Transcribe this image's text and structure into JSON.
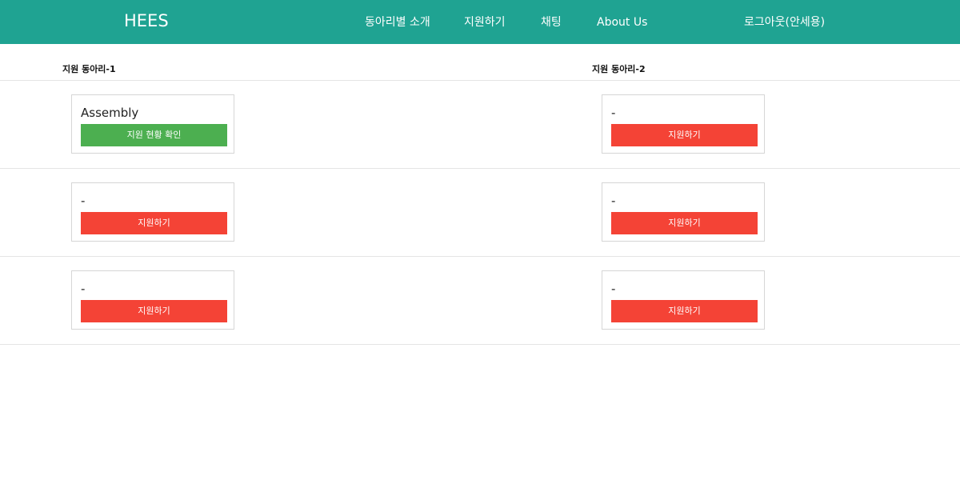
{
  "navbar": {
    "brand": "HEES",
    "links": [
      "동아리별 소개",
      "지원하기",
      "채팅",
      "About Us"
    ],
    "user_link": "로그아웃(안세용)",
    "color": "#1fa392"
  },
  "columns": [
    {
      "header": "지원 동아리-1",
      "cards": [
        {
          "title": "Assembly",
          "button": "지원 현황 확인",
          "button_color": "#4caf50"
        },
        {
          "title": "-",
          "button": "지원하기",
          "button_color": "#f44336"
        },
        {
          "title": "-",
          "button": "지원하기",
          "button_color": "#f44336"
        }
      ]
    },
    {
      "header": "지원 동아리-2",
      "cards": [
        {
          "title": "-",
          "button": "지원하기",
          "button_color": "#f44336"
        },
        {
          "title": "-",
          "button": "지원하기",
          "button_color": "#f44336"
        },
        {
          "title": "-",
          "button": "지원하기",
          "button_color": "#f44336"
        }
      ]
    }
  ]
}
